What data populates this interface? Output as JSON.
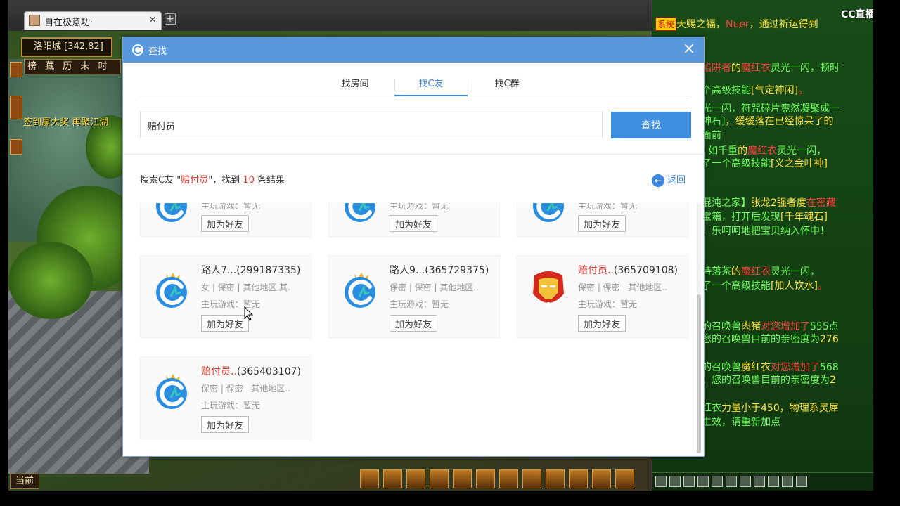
{
  "browser": {
    "tab_title": "自在极意功·",
    "tab_close": "×",
    "new_tab": "+"
  },
  "game": {
    "location": "洛阳城 [342,82]",
    "menu_strip": "榜 藏 历  未 时",
    "event_text": "签到赢大奖  再聚江湖",
    "current_label": "当前"
  },
  "chat": {
    "logo": "CC直播",
    "lines": [
      {
        "pre_tag": "系统",
        "text_a": "天赐之福，",
        "name": "Nuer",
        "text_b": "，",
        "text_c": "通过祈运得到"
      },
      {
        "text_a": "",
        "name": "陷阱者",
        "text_b": "的",
        "text_c": "魔红衣",
        "text_d": "灵光一闪，顿时"
      },
      {
        "text_a": "个高级技能",
        "text_b": "[气定神闲]",
        "text_c": "。"
      },
      {
        "text_a": "光一闪，符咒碎片竟然凝聚成一"
      },
      {
        "text_a": "神石]",
        "text_b": "，缓缓落在已经惊呆了的"
      },
      {
        "text_a": "面前"
      },
      {
        "text_a": "/ 如千重",
        "text_b": "的",
        "text_c": "魔红衣",
        "text_d": "灵光一闪，"
      },
      {
        "text_a": "了一个高级技能",
        "text_b": "[义之金叶神]"
      },
      {
        "text_a": "混沌之家】",
        "text_b": "张龙2强者度",
        "text_c": "在密藏"
      },
      {
        "text_a": "宝箱，打开后发现",
        "text_b": "[千年魂石]"
      },
      {
        "text_a": "，乐呵呵地把宝贝纳入怀中！"
      },
      {
        "text_a": "诗落茶",
        "text_b": "的",
        "text_c": "魔红衣",
        "text_d": "灵光一闪，"
      },
      {
        "text_a": "了一个高级技能",
        "text_b": "[加人饮水]",
        "text_c": "。"
      },
      {
        "text_a": "的召唤兽",
        "text_b": "肉猪",
        "text_c": "对您增加了",
        "text_d": "555",
        "text_e": "点"
      },
      {
        "text_a": "您的召唤兽目前的亲密度为",
        "text_b": "276"
      },
      {
        "text_a": "的召唤兽",
        "text_b": "魔红衣",
        "text_c": "对您增加了",
        "text_d": "568"
      },
      {
        "text_a": "。您的召唤兽目前的亲密度为",
        "text_b": "2"
      },
      {
        "text_a": "红衣",
        "text_b": "力量小于450，物理系灵犀"
      },
      {
        "text_a": "生效，请重新加点"
      }
    ]
  },
  "dialog": {
    "title": "查找",
    "close": "×",
    "tabs": [
      "找房间",
      "找C友",
      "找C群"
    ],
    "active_tab": "找C友",
    "search_value": "赔付员",
    "search_button": "查找",
    "result_prefix": "搜索C友 \"",
    "result_keyword": "赔付员",
    "result_mid": "\"，找到",
    "result_count": "10",
    "result_suffix": "条结果",
    "back_label": "返回",
    "back_icon": "←"
  },
  "cards_top": [
    {
      "game": "主玩游戏：暂无",
      "add": "加为好友"
    },
    {
      "game": "主玩游戏：暂无",
      "add": "加为好友"
    },
    {
      "game": "主玩游戏：暂无",
      "add": "加为好友"
    }
  ],
  "cards": [
    {
      "name": "路人7...",
      "id": "(299187335)",
      "highlight": false,
      "meta": "女 | 保密 | 其他地区 其.",
      "game": "主玩游戏：暂无",
      "add": "加为好友",
      "avatar": "cc-logo-icon"
    },
    {
      "name": "路人9...",
      "id": "(365729375)",
      "highlight": false,
      "meta": "保密 | 保密 | 其他地区..",
      "game": "主玩游戏：暂无",
      "add": "加为好友",
      "avatar": "cc-logo-icon"
    },
    {
      "name": "赔付员..",
      "id": "(365709108)",
      "highlight": true,
      "meta": "保密 | 保密 | 其他地区..",
      "game": "主玩游戏：暂无",
      "add": "加为好友",
      "avatar": "ironman-icon"
    },
    {
      "name": "赔付员..",
      "id": "(365403107)",
      "highlight": true,
      "meta": "保密 | 保密 | 其他地区..",
      "game": "主玩游戏：暂无",
      "add": "加为好友",
      "avatar": "cc-logo-icon"
    }
  ],
  "colors": {
    "accent": "#3d8fe0",
    "title_bar": "#5a98dd",
    "highlight": "#e2382d"
  }
}
